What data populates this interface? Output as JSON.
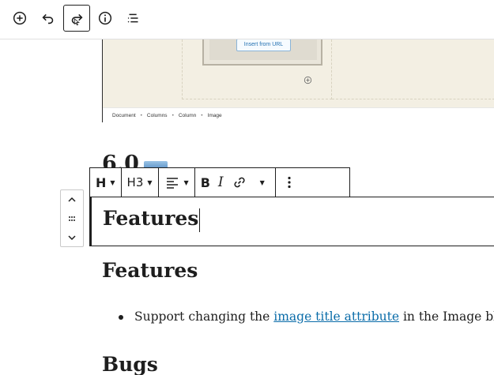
{
  "top_toolbar": {
    "buttons": [
      {
        "name": "add-block",
        "icon": "plus-circle-icon"
      },
      {
        "name": "undo",
        "icon": "undo-icon"
      },
      {
        "name": "redo",
        "icon": "redo-icon",
        "active": true
      },
      {
        "name": "details",
        "icon": "info-icon"
      },
      {
        "name": "list-view",
        "icon": "list-view-icon"
      }
    ]
  },
  "embedded_screenshot": {
    "insert_url_label": "Insert from URL",
    "breadcrumb": [
      "Document",
      "Columns",
      "Column",
      "Image"
    ]
  },
  "content": {
    "hidden_heading": "6.0",
    "active_heading": "Features",
    "heading_features": "Features",
    "list_item": {
      "before": "Support changing the ",
      "link": "image title attribute",
      "after": " in the Image bloc"
    },
    "heading_bugs": "Bugs"
  },
  "block_toolbar": {
    "block_type_icon": "H",
    "heading_level": "H3"
  },
  "colors": {
    "text": "#1e1e1e",
    "link": "#0a6ca9",
    "toolbar_border": "#1e1e1e"
  }
}
